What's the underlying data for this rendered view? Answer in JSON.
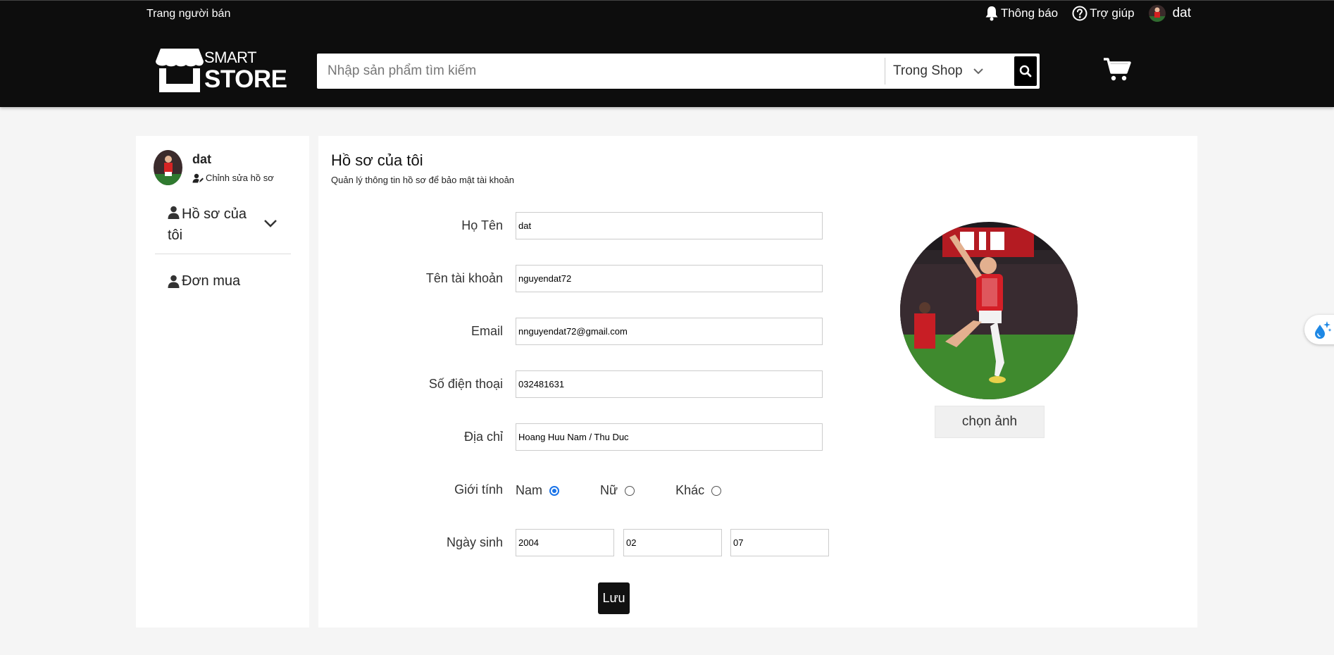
{
  "header": {
    "seller_link": "Trang người bán",
    "notifications": "Thông báo",
    "help": "Trợ giúp",
    "username": "dat",
    "logo_top": "SMART",
    "logo_bottom": "STORE",
    "search": {
      "placeholder": "Nhập sản phẩm tìm kiếm",
      "scope": "Trong Shop"
    },
    "icons": [
      "bell-icon",
      "help-icon",
      "search-icon",
      "cart-icon",
      "chevron-down-icon"
    ]
  },
  "sidebar": {
    "name": "dat",
    "edit_label": "Chỉnh sửa hồ sơ",
    "items": [
      {
        "label": "Hồ sơ của tôi",
        "icon": "user-icon"
      },
      {
        "label": "Đơn mua",
        "icon": "user-icon"
      }
    ]
  },
  "main": {
    "title": "Hồ sơ của tôi",
    "subtitle": "Quản lý thông tin hồ sơ để bảo mật tài khoản",
    "fields": {
      "full_name": {
        "label": "Họ Tên",
        "value": "dat"
      },
      "username": {
        "label": "Tên tài khoản",
        "value": "nguyendat72"
      },
      "email": {
        "label": "Email",
        "value": "nnguyendat72@gmail.com"
      },
      "phone": {
        "label": "Số điện thoại",
        "value": "032481631"
      },
      "address": {
        "label": "Địa chỉ",
        "value": "Hoang Huu Nam / Thu Duc"
      }
    },
    "gender": {
      "label": "Giới tính",
      "options": [
        "Nam",
        "Nữ",
        "Khác"
      ],
      "selected": "Nam"
    },
    "dob": {
      "label": "Ngày sinh",
      "year": "2004",
      "month": "02",
      "day": "07"
    },
    "save_label": "Lưu",
    "choose_image_label": "chọn ảnh"
  },
  "colors": {
    "header_bg": "#0d0d0d",
    "page_bg": "#f5f5f5",
    "radio_accent": "#1a73e8",
    "float_icon": "#1e88e5"
  }
}
